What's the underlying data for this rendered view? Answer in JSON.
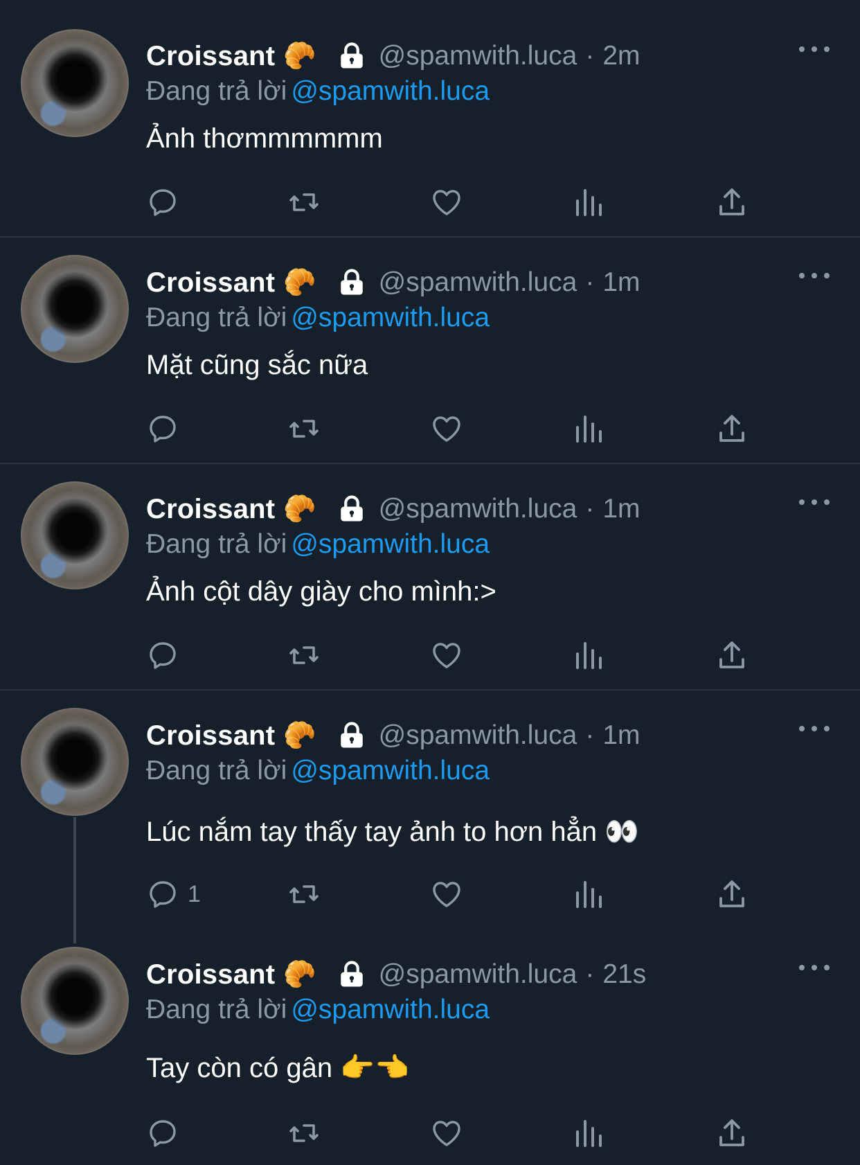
{
  "colors": {
    "background": "#15202b",
    "secondary_text": "#8b98a5",
    "mention": "#1d9bf0",
    "divider": "#2b3640"
  },
  "icons": {
    "display_emoji": "croissant-icon",
    "lock": "lock-icon",
    "reply": "reply-icon",
    "retweet": "retweet-icon",
    "like": "heart-icon",
    "views": "views-icon",
    "share": "share-icon",
    "more": "more-icon"
  },
  "tweets": [
    {
      "name": "Croissant",
      "emoji": "🥐",
      "handle": "@spamwith.luca",
      "separator": "·",
      "time": "2m",
      "replying_label": "Đang trả lời",
      "replying_to": "@spamwith.luca",
      "text": "Ảnh thơmmmmmm",
      "reply_count": ""
    },
    {
      "name": "Croissant",
      "emoji": "🥐",
      "handle": "@spamwith.luca",
      "separator": "·",
      "time": "1m",
      "replying_label": "Đang trả lời",
      "replying_to": "@spamwith.luca",
      "text": "Mặt cũng sắc nữa",
      "reply_count": ""
    },
    {
      "name": "Croissant",
      "emoji": "🥐",
      "handle": "@spamwith.luca",
      "separator": "·",
      "time": "1m",
      "replying_label": "Đang trả lời",
      "replying_to": "@spamwith.luca",
      "text": "Ảnh cột dây giày cho mình:>",
      "reply_count": ""
    },
    {
      "name": "Croissant",
      "emoji": "🥐",
      "handle": "@spamwith.luca",
      "separator": "·",
      "time": "1m",
      "replying_label": "Đang trả lời",
      "replying_to": "@spamwith.luca",
      "text": "Lúc nắm tay thấy tay ảnh to hơn hẳn 👀",
      "reply_count": "1"
    },
    {
      "name": "Croissant",
      "emoji": "🥐",
      "handle": "@spamwith.luca",
      "separator": "·",
      "time": "21s",
      "replying_label": "Đang trả lời",
      "replying_to": "@spamwith.luca",
      "text": "Tay còn có gân 👉👈",
      "reply_count": ""
    }
  ]
}
